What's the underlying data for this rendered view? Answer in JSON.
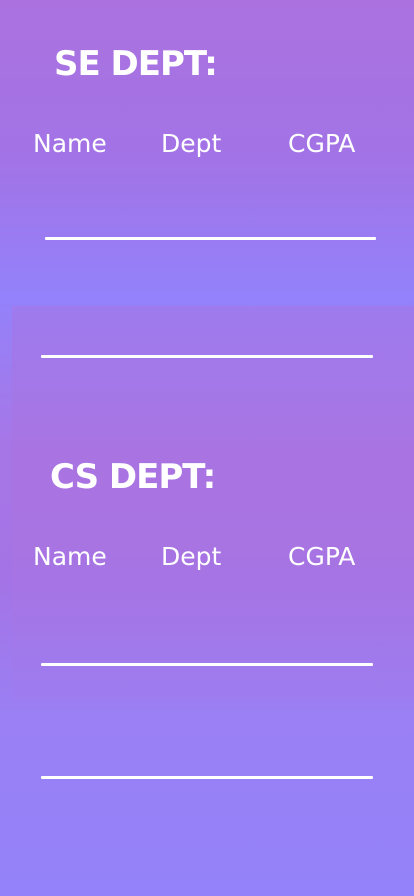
{
  "se_section": {
    "title": "SE DEPT:",
    "columns": [
      "Name",
      "Dept",
      "CGPA"
    ]
  },
  "cs_section": {
    "title": "CS DEPT:",
    "columns": [
      "Name",
      "Dept",
      "CGPA"
    ]
  },
  "colors": {
    "text": "#ffffff",
    "background_top": "#ab72df",
    "background_mid": "#9382fb",
    "background_bottom": "#9482fa"
  }
}
